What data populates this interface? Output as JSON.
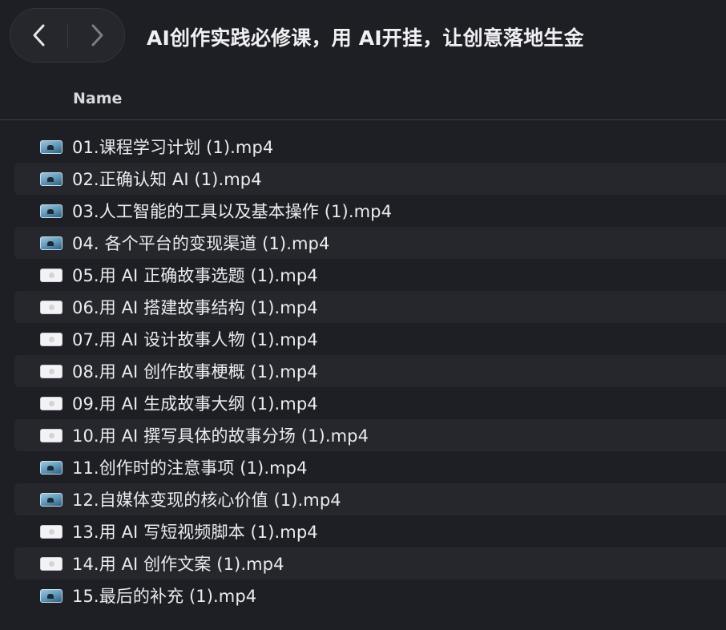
{
  "window": {
    "title": "AI创作实践必修课，用 AI开挂，让创意落地生金"
  },
  "toolbar": {
    "back_icon": "chevron-left-icon",
    "forward_icon": "chevron-right-icon"
  },
  "columns": {
    "name": "Name"
  },
  "files": [
    {
      "name": "01.课程学习计划 (1).mp4",
      "icon": "video-thumbnail-icon"
    },
    {
      "name": "02.正确认知 AI (1).mp4",
      "icon": "video-thumbnail-icon"
    },
    {
      "name": "03.人工智能的工具以及基本操作  (1).mp4",
      "icon": "video-thumbnail-icon"
    },
    {
      "name": "04. 各个平台的变现渠道 (1).mp4",
      "icon": "video-thumbnail-icon"
    },
    {
      "name": "05.用 AI 正确故事选题  (1).mp4",
      "icon": "video-file-icon"
    },
    {
      "name": "06.用 AI 搭建故事结构  (1).mp4",
      "icon": "video-file-icon"
    },
    {
      "name": "07.用 AI 设计故事人物 (1).mp4",
      "icon": "video-file-icon"
    },
    {
      "name": "08.用 AI 创作故事梗概 (1).mp4",
      "icon": "video-file-icon"
    },
    {
      "name": "09.用 AI 生成故事大纲  (1).mp4",
      "icon": "video-file-icon"
    },
    {
      "name": "10.用 AI 撰写具体的故事分场 (1).mp4",
      "icon": "video-file-icon"
    },
    {
      "name": "11.创作时的注意事项  (1).mp4",
      "icon": "video-thumbnail-icon"
    },
    {
      "name": "12.自媒体变现的核心价值 (1).mp4",
      "icon": "video-thumbnail-icon"
    },
    {
      "name": "13.用 AI 写短视频脚本  (1).mp4",
      "icon": "video-file-icon"
    },
    {
      "name": "14.用 AI 创作文案  (1).mp4",
      "icon": "video-file-icon"
    },
    {
      "name": "15.最后的补充 (1).mp4",
      "icon": "video-thumbnail-icon"
    }
  ]
}
